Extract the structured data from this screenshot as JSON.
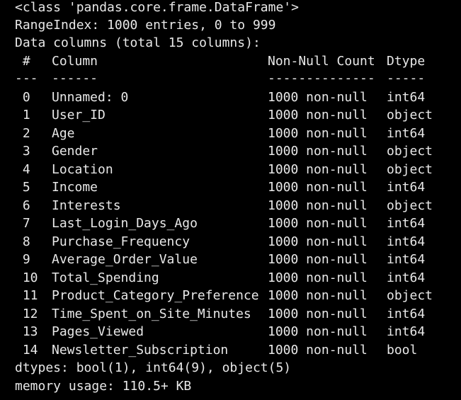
{
  "class_line": "<class 'pandas.core.frame.DataFrame'>",
  "range_index": "RangeIndex: 1000 entries, 0 to 999",
  "data_columns": "Data columns (total 15 columns):",
  "header": {
    "idx": " #",
    "column": "Column",
    "non_null": "Non-Null Count",
    "dtype": "Dtype"
  },
  "separator": {
    "idx": "---",
    "column": "------",
    "non_null": "--------------",
    "dtype": "-----"
  },
  "rows": [
    {
      "idx": " 0",
      "column": "Unnamed: 0",
      "non_null": "1000 non-null",
      "dtype": "int64"
    },
    {
      "idx": " 1",
      "column": "User_ID",
      "non_null": "1000 non-null",
      "dtype": "object"
    },
    {
      "idx": " 2",
      "column": "Age",
      "non_null": "1000 non-null",
      "dtype": "int64"
    },
    {
      "idx": " 3",
      "column": "Gender",
      "non_null": "1000 non-null",
      "dtype": "object"
    },
    {
      "idx": " 4",
      "column": "Location",
      "non_null": "1000 non-null",
      "dtype": "object"
    },
    {
      "idx": " 5",
      "column": "Income",
      "non_null": "1000 non-null",
      "dtype": "int64"
    },
    {
      "idx": " 6",
      "column": "Interests",
      "non_null": "1000 non-null",
      "dtype": "object"
    },
    {
      "idx": " 7",
      "column": "Last_Login_Days_Ago",
      "non_null": "1000 non-null",
      "dtype": "int64"
    },
    {
      "idx": " 8",
      "column": "Purchase_Frequency",
      "non_null": "1000 non-null",
      "dtype": "int64"
    },
    {
      "idx": " 9",
      "column": "Average_Order_Value",
      "non_null": "1000 non-null",
      "dtype": "int64"
    },
    {
      "idx": " 10",
      "column": "Total_Spending",
      "non_null": "1000 non-null",
      "dtype": "int64"
    },
    {
      "idx": " 11",
      "column": "Product_Category_Preference",
      "non_null": "1000 non-null",
      "dtype": "object"
    },
    {
      "idx": " 12",
      "column": "Time_Spent_on_Site_Minutes",
      "non_null": "1000 non-null",
      "dtype": "int64"
    },
    {
      "idx": " 13",
      "column": "Pages_Viewed",
      "non_null": "1000 non-null",
      "dtype": "int64"
    },
    {
      "idx": " 14",
      "column": "Newsletter_Subscription",
      "non_null": "1000 non-null",
      "dtype": "bool"
    }
  ],
  "dtypes_line": "dtypes: bool(1), int64(9), object(5)",
  "memory_line": "memory usage: 110.5+ KB"
}
